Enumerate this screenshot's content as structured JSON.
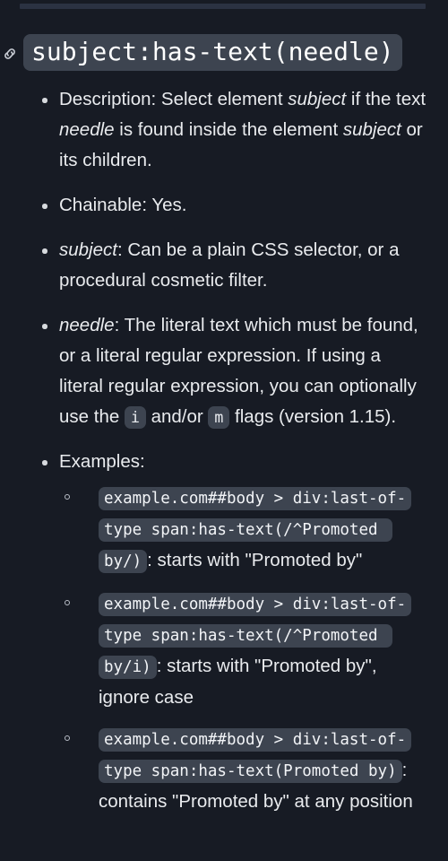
{
  "theme": {
    "background": "#171b24",
    "text": "#e9ebee",
    "code_background": "#3d4450",
    "code_text": "#f2f4f7",
    "topbar": "#2b3242"
  },
  "heading": {
    "anchor_icon": "link-icon",
    "code_title": "subject:has-text(needle)"
  },
  "items": {
    "description": {
      "prefix": "Description: Select element ",
      "em1": "subject",
      "mid1": " if the text ",
      "em2": "needle",
      "mid2": " is found inside the element ",
      "em3": "subject",
      "suffix": " or its children."
    },
    "chainable": {
      "text": "Chainable: Yes."
    },
    "subject": {
      "em": "subject",
      "text": ": Can be a plain CSS selector, or a procedural cosmetic filter."
    },
    "needle": {
      "em": "needle",
      "part1": ": The literal text which must be found, or a literal regular expression. If using a literal regular expression, you can optionally use the ",
      "flag_i": "i",
      "part2": " and/or ",
      "flag_m": "m",
      "part3": " flags (version 1.15)."
    },
    "examples": {
      "label": "Examples:",
      "entries": [
        {
          "code": "example.com##body > div:last-of-type span:has-text(/^Promoted by/)",
          "note": ": starts with \"Promoted by\""
        },
        {
          "code": "example.com##body > div:last-of-type span:has-text(/^Promoted by/i)",
          "note": ": starts with \"Promoted by\", ignore case"
        },
        {
          "code": "example.com##body > div:last-of-type span:has-text(Promoted by)",
          "note": ": contains \"Promoted by\" at any position"
        }
      ]
    }
  }
}
